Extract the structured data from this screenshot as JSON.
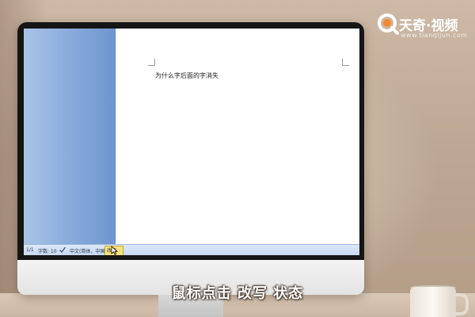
{
  "logo": {
    "title_part1": "天奇",
    "title_sep": "·",
    "title_part2": "视频",
    "url": "www.tianqijun.com",
    "brand_color": "#f28a2e"
  },
  "document": {
    "text": "为什么字后面的字消失"
  },
  "status_bar": {
    "page": "1/1",
    "word_count": "字数: 10",
    "proofing_icon": "check-icon",
    "language": "中文(简体，中国)",
    "mode": "改写"
  },
  "subtitle": "鼠标点击 改写 状态",
  "colors": {
    "side_panel": "#8fb0de",
    "status_bar": "#c5d8f0",
    "mode_highlight": "#f7e27a"
  }
}
